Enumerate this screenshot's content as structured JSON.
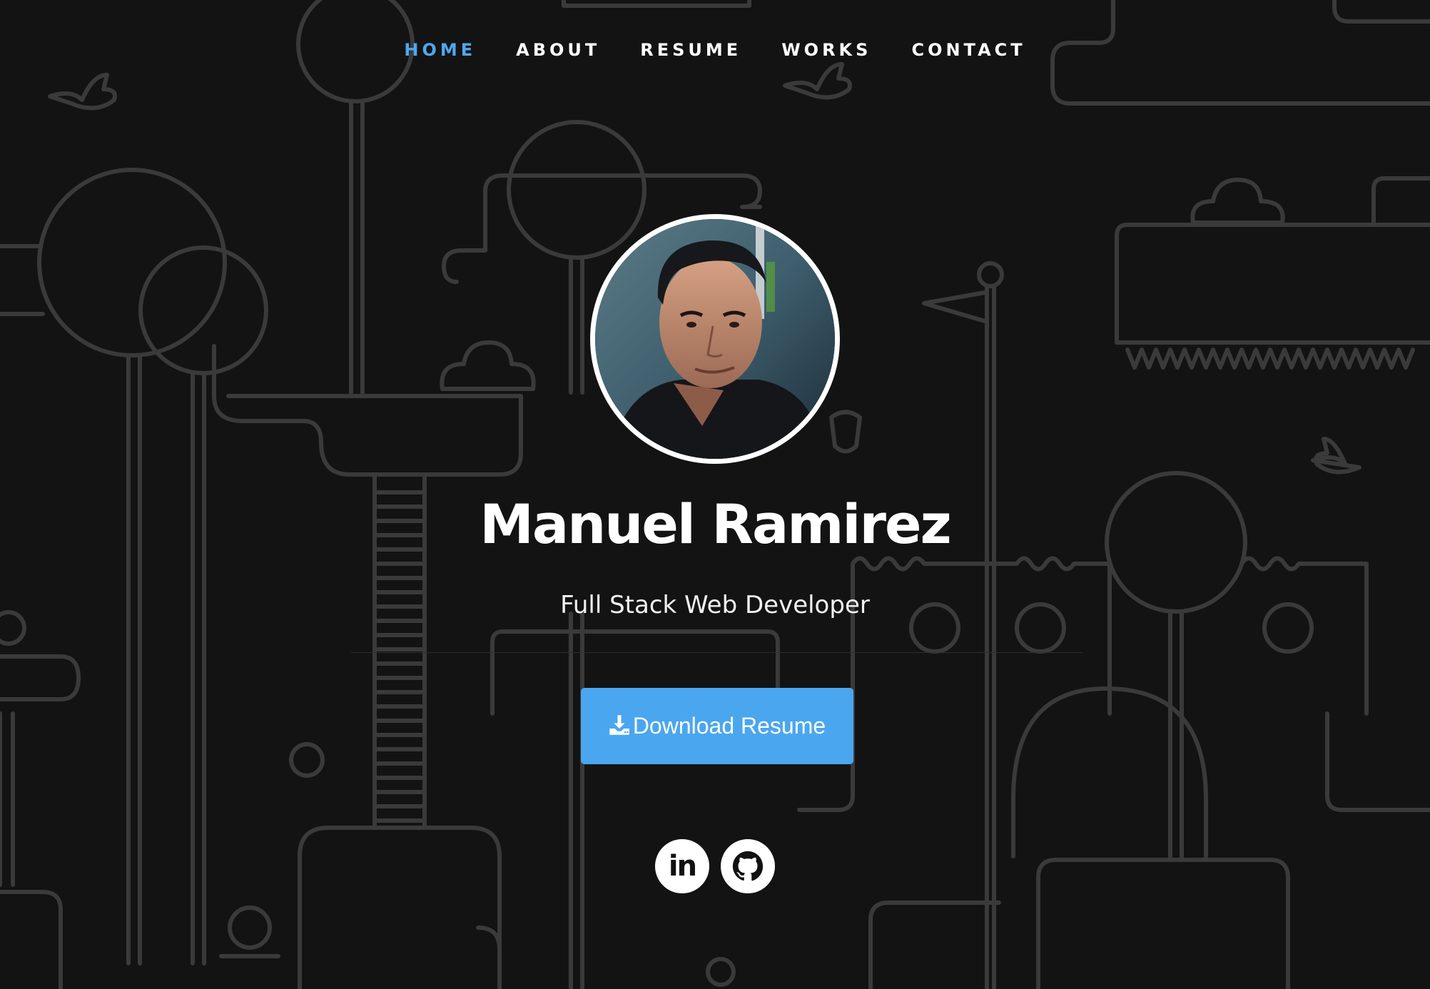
{
  "nav": {
    "items": [
      {
        "label": "HOME",
        "active": true
      },
      {
        "label": "ABOUT",
        "active": false
      },
      {
        "label": "RESUME",
        "active": false
      },
      {
        "label": "WORKS",
        "active": false
      },
      {
        "label": "CONTACT",
        "active": false
      }
    ]
  },
  "hero": {
    "name": "Manuel Ramirez",
    "role": "Full Stack Web Developer",
    "download_label": "Download Resume",
    "download_icon": "download-icon"
  },
  "social": {
    "linkedin_icon": "linkedin-icon",
    "linkedin_text": "in",
    "github_icon": "github-icon"
  },
  "colors": {
    "accent": "#4aa6ee",
    "nav_active": "#4ea8ee",
    "background": "#131313",
    "line_art": "#3a3a3a"
  }
}
